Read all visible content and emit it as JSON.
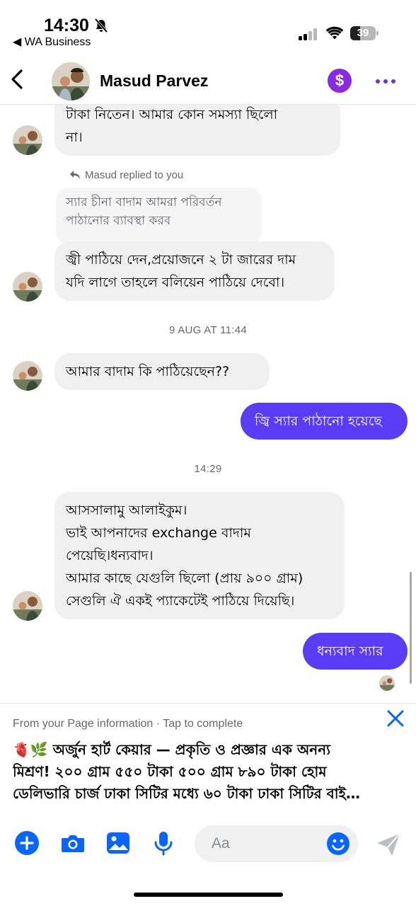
{
  "status_bar": {
    "time": "14:30",
    "back_app": "◀ WA Business",
    "battery": "39",
    "battery_level": 0.39
  },
  "header": {
    "contact_name": "Masud Parvez",
    "pay_icon": "$"
  },
  "messages": {
    "m1": {
      "lines": [
        "টাকা নিতেন। আমার কোন সমস্যা ছিলো",
        "না।"
      ]
    },
    "replied_note": "Masud replied to you",
    "reply_quote": {
      "lines": [
        "স্যার চীনা বাদাম আমরা পরিবর্তন",
        "পাঠানোর ব্যাবস্থা করব"
      ]
    },
    "m2": {
      "lines": [
        "জ্বী পাঠিয়ে দেন,প্রয়োজনে ২ টা জারের দাম",
        "যদি লাগে তাহলে বলিয়েন পাঠিয়ে দেবো।"
      ]
    },
    "date_1": "9 AUG AT 11:44",
    "m3": {
      "lines": [
        "আমার বাদাম কি পাঠিয়েছেন??"
      ]
    },
    "m4_out": {
      "lines": [
        "জ্বি স্যার পাঠানো হয়েছে"
      ]
    },
    "date_2": "14:29",
    "m5": {
      "lines": [
        "আসসালামু আলাইকুম।",
        "ভাই আপনাদের exchange  বাদাম",
        "পেয়েছি।ধন্যবাদ।",
        "আমার কাছে যেগুলি ছিলো (প্রায় ৯০০ গ্রাম)",
        "সেগুলি ঐ একই প্যাকেটেই পাঠিয়ে দিয়েছি।"
      ]
    },
    "m6_out": {
      "lines": [
        "ধন্যবাদ স্যার"
      ]
    }
  },
  "info_banner": {
    "heading": "From your Page information · Tap to complete",
    "lines": [
      "🫀🌿 অর্জুন হার্ট কেয়ার — প্রকৃতি ও প্রজ্ঞার এক অনন্য",
      "মিশ্রণ! ২০০ গ্রাম ৫৫০ টাকা ৫০০ গ্রাম ৮৯০ টাকা হোম",
      "ডেলিভারি চার্জ ঢাকা সিটির মধ্যে ৬০ টাকা ঢাকা সিটির বাই…"
    ]
  },
  "composer": {
    "placeholder": "Aa"
  },
  "colors": {
    "accent": "#0866ff",
    "outgoing_bubble": "#5b3cf6",
    "incoming_bubble": "#f0f0f0",
    "pay_badge": "#8a2be2",
    "more_dots": "#7b2cd9"
  }
}
